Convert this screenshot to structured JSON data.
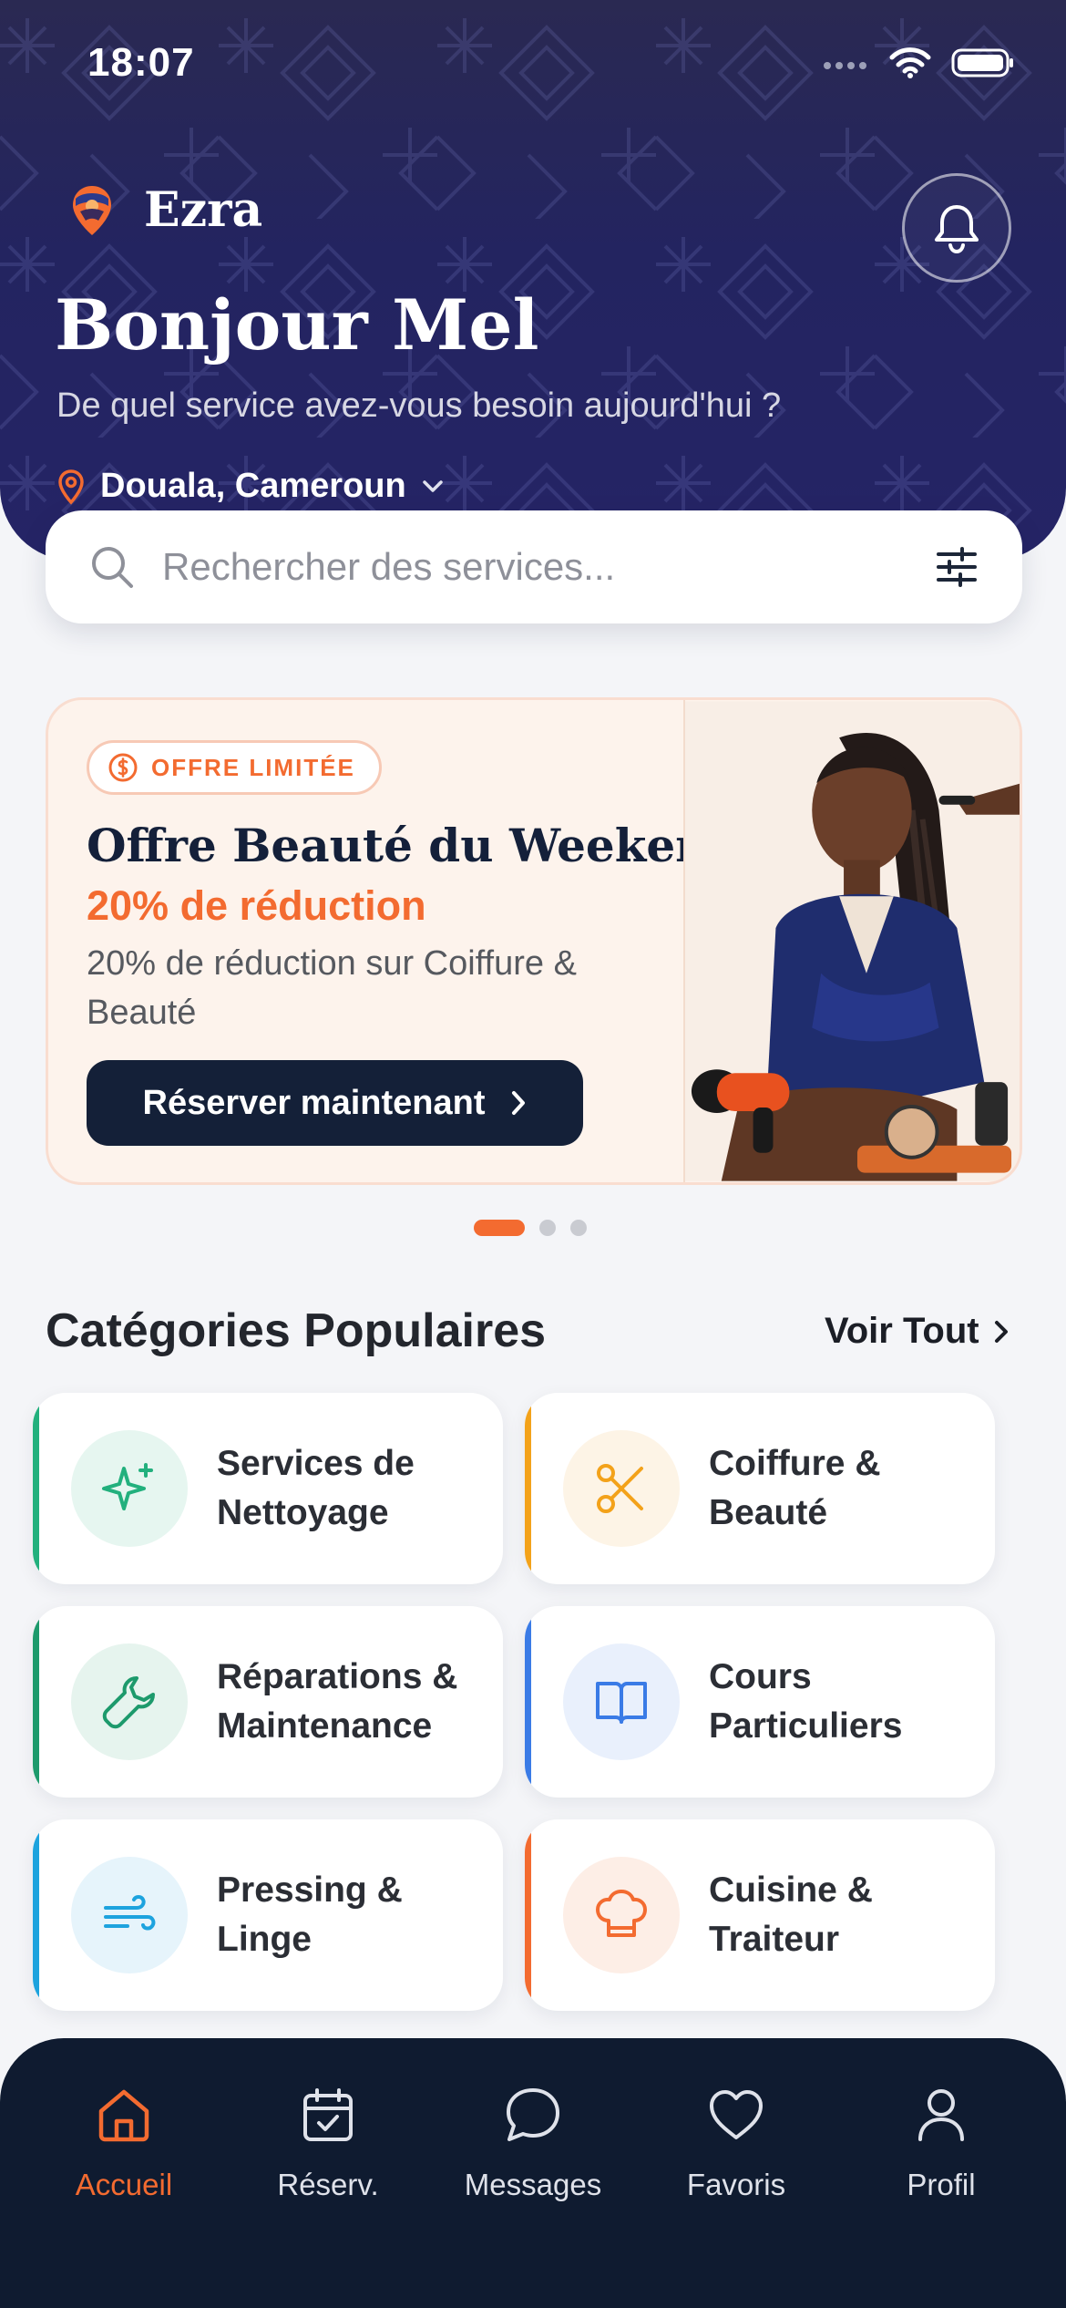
{
  "status_bar": {
    "time": "18:07"
  },
  "header": {
    "brand": "Ezra",
    "greeting": "Bonjour Mel",
    "subtitle": "De quel service avez-vous besoin aujourd'hui ?",
    "location": "Douala, Cameroun"
  },
  "search": {
    "placeholder": "Rechercher des services..."
  },
  "promo": {
    "badge": "OFFRE LIMITÉE",
    "title": "Offre Beauté du Weekend",
    "discount": "20% de réduction",
    "description": "20% de réduction sur Coiffure & Beauté",
    "cta": "Réserver maintenant",
    "pager": {
      "count": 3,
      "active_index": 0
    }
  },
  "categories": {
    "title": "Catégories Populaires",
    "see_all": "Voir Tout",
    "items": [
      {
        "label": "Services de Nettoyage",
        "icon": "sparkle-icon",
        "accent": "#22b07d",
        "bg": "#e6f6f0"
      },
      {
        "label": "Coiffure & Beauté",
        "icon": "scissors-icon",
        "accent": "#f3a21a",
        "bg": "#fdf4e6"
      },
      {
        "label": "Réparations & Maintenance",
        "icon": "wrench-icon",
        "accent": "#1d9a6c",
        "bg": "#e6f4ee"
      },
      {
        "label": "Cours Particuliers",
        "icon": "book-icon",
        "accent": "#3a7be6",
        "bg": "#e9f0fc"
      },
      {
        "label": "Pressing & Linge",
        "icon": "wind-icon",
        "accent": "#1da3de",
        "bg": "#e6f4fb"
      },
      {
        "label": "Cuisine & Traiteur",
        "icon": "chef-hat-icon",
        "accent": "#f36b30",
        "bg": "#fdeee6"
      }
    ]
  },
  "bottom_nav": {
    "items": [
      {
        "label": "Accueil",
        "icon": "home-icon",
        "active": true
      },
      {
        "label": "Réserv.",
        "icon": "calendar-icon",
        "active": false
      },
      {
        "label": "Messages",
        "icon": "chat-icon",
        "active": false
      },
      {
        "label": "Favoris",
        "icon": "heart-icon",
        "active": false
      },
      {
        "label": "Profil",
        "icon": "user-icon",
        "active": false
      }
    ]
  },
  "colors": {
    "accent": "#f36b30",
    "header_bg": "#242460",
    "navy": "#142038",
    "nav_bg": "#0f1b30"
  }
}
